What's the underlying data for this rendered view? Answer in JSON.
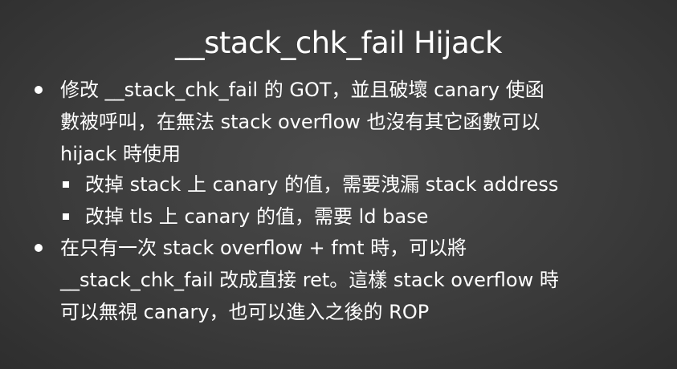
{
  "title": "__stack_chk_fail Hijack",
  "bullets": [
    {
      "lines": [
        "修改 __stack_chk_fail 的 GOT，並且破壞 canary 使函",
        "數被呼叫，在無法 stack overflow 也沒有其它函數可以",
        "hijack 時使用"
      ],
      "sub_items": [
        "改掉 stack 上 canary 的值，需要洩漏 stack address",
        "改掉 tls 上 canary 的值，需要 ld base"
      ]
    },
    {
      "lines": [
        "在只有一次 stack overflow + fmt 時，可以將",
        "__stack_chk_fail 改成直接 ret。這樣 stack overflow 時",
        "可以無視 canary，也可以進入之後的 ROP"
      ]
    }
  ]
}
